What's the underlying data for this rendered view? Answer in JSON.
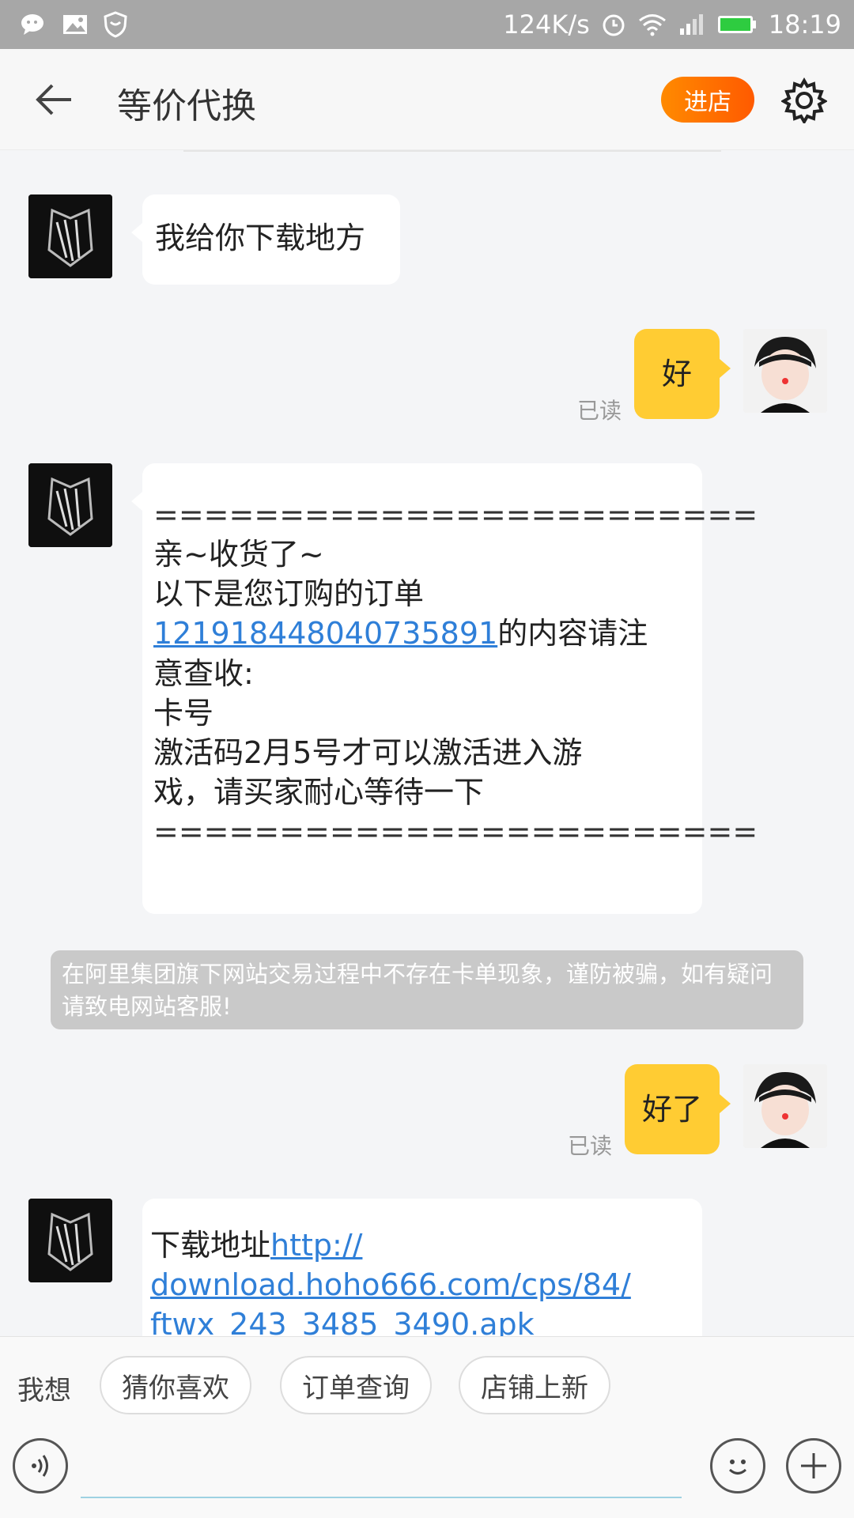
{
  "status_bar": {
    "network_speed": "124K/s",
    "time": "18:19",
    "icons": [
      "wechat-icon",
      "image-icon",
      "shield-icon",
      "alarm-icon",
      "wifi-icon",
      "signal-icon",
      "battery-icon"
    ]
  },
  "header": {
    "title": "等价代换",
    "shop_button": "进店",
    "icons": [
      "back-arrow-icon",
      "gear-icon"
    ]
  },
  "messages": [
    {
      "side": "left",
      "text": "我给你下载地方"
    },
    {
      "side": "right",
      "text": "好",
      "status": "已读"
    },
    {
      "side": "left",
      "lines": [
        "========================",
        "亲~收货了~",
        "以下是您订购的订单",
        "的内容请注",
        "意查收:",
        "卡号",
        "激活码2月5号才可以激活进入游",
        "戏，请买家耐心等待一下",
        "========================"
      ],
      "order_number": "1219184480407358​91"
    },
    {
      "side": "right",
      "text": "好了",
      "status": "已读"
    },
    {
      "side": "left",
      "prefix": "下载地址",
      "link_lines": [
        "http://",
        "download.hoho666.com/cps/84/",
        "ftwx_243_3485_3490.apk"
      ]
    }
  ],
  "notice": "在阿里集团旗下网站交易过程中不存在卡单现象，谨防被骗，如有疑问请致电网站客服!",
  "quick_bar": {
    "label": "我想",
    "chips": [
      "猜你喜欢",
      "订单查询",
      "店铺上新"
    ]
  },
  "input_bar": {
    "icons": [
      "voice-icon",
      "emoji-icon",
      "plus-icon"
    ]
  },
  "colors": {
    "status_bar": "#a7a7a7",
    "user_bubble": "#ffcc33",
    "shop_button": "#ff6a00",
    "link": "#2f7fd8"
  }
}
